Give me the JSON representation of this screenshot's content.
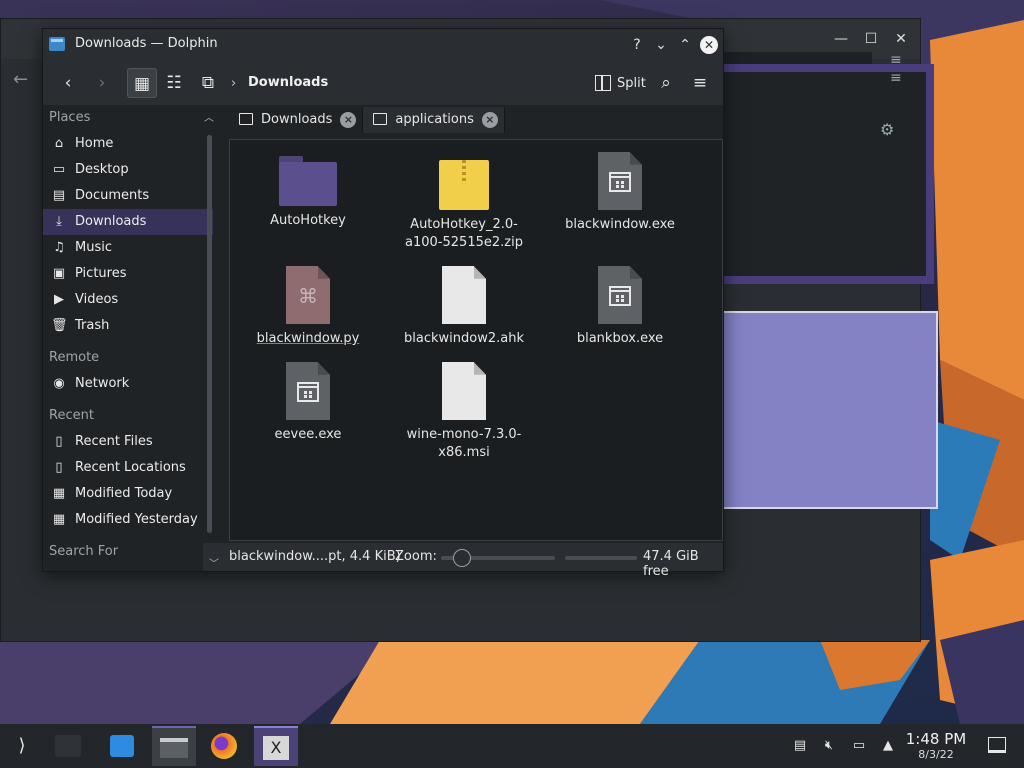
{
  "window": {
    "title": "Downloads — Dolphin",
    "help_label": "?",
    "minimize_label": "⌄",
    "maximize_label": "⌃",
    "close_label": "✕"
  },
  "background_window": {
    "minimize_label": "—",
    "maximize_label": "☐",
    "close_label": "✕"
  },
  "toolbar": {
    "breadcrumb": "Downloads",
    "split_label": "Split"
  },
  "sidebar": {
    "sections": [
      {
        "heading": "Places",
        "items": [
          {
            "label": "Home",
            "icon": "home-icon"
          },
          {
            "label": "Desktop",
            "icon": "desktop-icon"
          },
          {
            "label": "Documents",
            "icon": "documents-icon"
          },
          {
            "label": "Downloads",
            "icon": "downloads-icon",
            "selected": true
          },
          {
            "label": "Music",
            "icon": "music-icon"
          },
          {
            "label": "Pictures",
            "icon": "pictures-icon"
          },
          {
            "label": "Videos",
            "icon": "videos-icon"
          },
          {
            "label": "Trash",
            "icon": "trash-icon"
          }
        ]
      },
      {
        "heading": "Remote",
        "items": [
          {
            "label": "Network",
            "icon": "network-icon"
          }
        ]
      },
      {
        "heading": "Recent",
        "items": [
          {
            "label": "Recent Files",
            "icon": "recent-files-icon"
          },
          {
            "label": "Recent Locations",
            "icon": "recent-locations-icon"
          },
          {
            "label": "Modified Today",
            "icon": "calendar-icon"
          },
          {
            "label": "Modified Yesterday",
            "icon": "calendar-icon"
          }
        ]
      },
      {
        "heading": "Search For",
        "items": []
      }
    ]
  },
  "tabs": [
    {
      "label": "Downloads",
      "active": true
    },
    {
      "label": "applications",
      "active": false
    }
  ],
  "files": [
    {
      "name": "AutoHotkey",
      "kind": "folder"
    },
    {
      "name": "AutoHotkey_2.0-a100-52515e2.zip",
      "line1": "AutoHotkey_2.0-",
      "line2": "a100-52515e2.zip",
      "kind": "zip"
    },
    {
      "name": "blackwindow.exe",
      "kind": "exe"
    },
    {
      "name": "blackwindow.py",
      "kind": "py",
      "selected": true
    },
    {
      "name": "blackwindow2.ahk",
      "kind": "doc"
    },
    {
      "name": "blankbox.exe",
      "kind": "exe"
    },
    {
      "name": "eevee.exe",
      "kind": "exe"
    },
    {
      "name": "wine-mono-7.3.0-x86.msi",
      "line1": "wine-mono-7.3.0-",
      "line2": "x86.msi",
      "kind": "doc"
    }
  ],
  "statusbar": {
    "selection_text": "blackwindow....pt, 4.4 KiB)",
    "zoom_label": "Zoom:",
    "free_space": "47.4 GiB free",
    "zoom_level": 0.18,
    "disk_used_fraction": 0.1
  },
  "taskbar": {
    "time": "1:48 PM",
    "date": "8/3/22",
    "apps": [
      "application-launcher-icon",
      "system-settings-icon",
      "discover-store-icon",
      "dolphin-file-manager-icon",
      "firefox-icon",
      "x-window-icon"
    ]
  },
  "colors": {
    "accent": "#6f63b5",
    "sidebar_selected": "#36325a",
    "overlay_fill": "#8482c4",
    "overlay_border": "#4a3d7e"
  }
}
